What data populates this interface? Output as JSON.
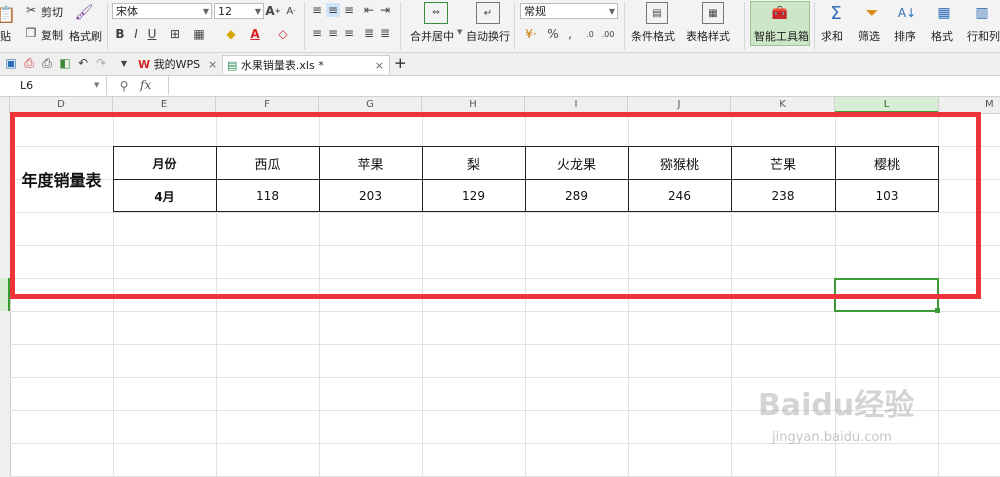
{
  "ribbon": {
    "paste": "贴",
    "cut": "剪切",
    "copy": "复制",
    "format_painter": "格式刷",
    "font_name": "宋体",
    "font_size": "12",
    "merge_center": "合并居中",
    "wrap_text": "自动换行",
    "number_format": "常规",
    "conditional_format": "条件格式",
    "table_style": "表格样式",
    "smart_toolbox": "智能工具箱",
    "sum": "求和",
    "filter": "筛选",
    "sort": "排序",
    "format": "格式",
    "rows_cols": "行和列"
  },
  "tabs": {
    "wps_home": "我的WPS",
    "document": "水果销量表.xls *"
  },
  "formula_bar": {
    "name_box": "L6",
    "fx": "fx",
    "value": ""
  },
  "columns": [
    "D",
    "E",
    "F",
    "G",
    "H",
    "I",
    "J",
    "K",
    "L",
    "M"
  ],
  "sheet": {
    "title": "年度销量表",
    "header_label": "月份",
    "row_label": "4月",
    "fruits": [
      "西瓜",
      "苹果",
      "梨",
      "火龙果",
      "猕猴桃",
      "芒果",
      "樱桃"
    ],
    "values": [
      "118",
      "203",
      "129",
      "289",
      "246",
      "238",
      "103"
    ]
  },
  "colors": {
    "highlight_red": "#f0353a",
    "selection_green": "#3d9b35",
    "active_tab": "#ffffff"
  },
  "watermark": {
    "brand": "Baidu经验",
    "url": "jingyan.baidu.com"
  }
}
